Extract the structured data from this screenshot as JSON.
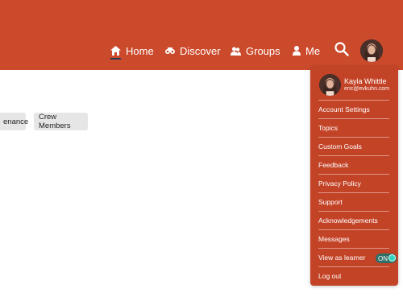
{
  "nav": {
    "home": "Home",
    "discover": "Discover",
    "groups": "Groups",
    "me": "Me"
  },
  "chips": [
    "enance",
    "Crew Members"
  ],
  "dropdown": {
    "user_name": "Kayla Whittle",
    "user_email": "eric@evkuhn.com",
    "items": [
      "Account Settings",
      "Topics",
      "Custom Goals",
      "Feedback",
      "Privacy Policy",
      "Support",
      "Acknowledgements",
      "Messages",
      "View as learner",
      "Log out"
    ],
    "toggle_label": "ON"
  },
  "colors": {
    "header": "#cc4a2c",
    "dropdown": "#c34327",
    "toggle_on": "#2dd4bf"
  },
  "icons": [
    "home-icon",
    "binoculars-icon",
    "groups-icon",
    "person-icon",
    "search-icon",
    "avatar"
  ]
}
